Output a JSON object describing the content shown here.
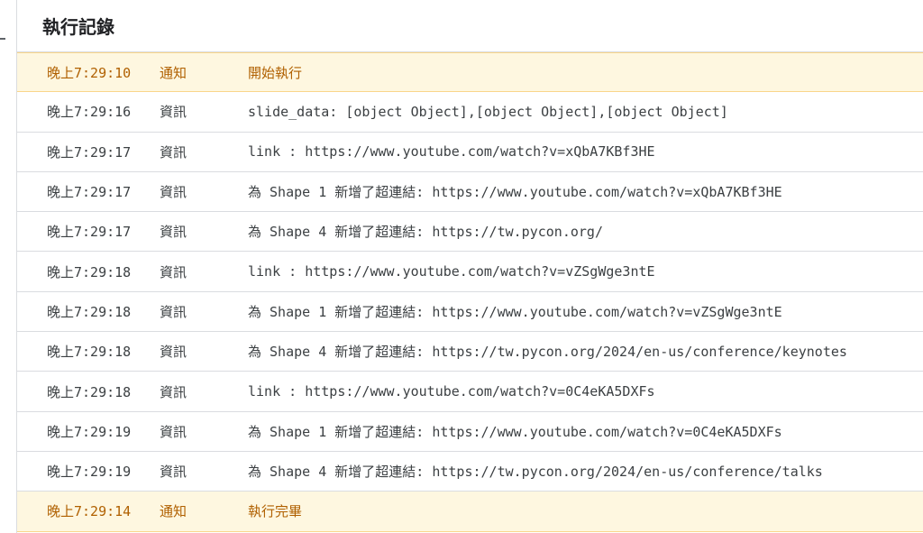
{
  "panel": {
    "title": "執行記錄"
  },
  "colors": {
    "notice_bg": "#fef7e0",
    "notice_text": "#b06000",
    "info_text": "#3c4043",
    "divider": "#dadce0"
  },
  "logs": [
    {
      "time": "晚上7:29:10",
      "level": "通知",
      "message": "開始執行",
      "type": "notice"
    },
    {
      "time": "晚上7:29:16",
      "level": "資訊",
      "message": "slide_data: [object Object],[object Object],[object Object]",
      "type": "info"
    },
    {
      "time": "晚上7:29:17",
      "level": "資訊",
      "message": "link : https://www.youtube.com/watch?v=xQbA7KBf3HE",
      "type": "info"
    },
    {
      "time": "晚上7:29:17",
      "level": "資訊",
      "message": "為 Shape 1 新增了超連結: https://www.youtube.com/watch?v=xQbA7KBf3HE",
      "type": "info"
    },
    {
      "time": "晚上7:29:17",
      "level": "資訊",
      "message": "為 Shape 4 新增了超連結: https://tw.pycon.org/",
      "type": "info"
    },
    {
      "time": "晚上7:29:18",
      "level": "資訊",
      "message": "link : https://www.youtube.com/watch?v=vZSgWge3ntE",
      "type": "info"
    },
    {
      "time": "晚上7:29:18",
      "level": "資訊",
      "message": "為 Shape 1 新增了超連結: https://www.youtube.com/watch?v=vZSgWge3ntE",
      "type": "info"
    },
    {
      "time": "晚上7:29:18",
      "level": "資訊",
      "message": "為 Shape 4 新增了超連結: https://tw.pycon.org/2024/en-us/conference/keynotes",
      "type": "info"
    },
    {
      "time": "晚上7:29:18",
      "level": "資訊",
      "message": "link : https://www.youtube.com/watch?v=0C4eKA5DXFs",
      "type": "info"
    },
    {
      "time": "晚上7:29:19",
      "level": "資訊",
      "message": "為 Shape 1 新增了超連結: https://www.youtube.com/watch?v=0C4eKA5DXFs",
      "type": "info"
    },
    {
      "time": "晚上7:29:19",
      "level": "資訊",
      "message": "為 Shape 4 新增了超連結: https://tw.pycon.org/2024/en-us/conference/talks",
      "type": "info"
    },
    {
      "time": "晚上7:29:14",
      "level": "通知",
      "message": "執行完畢",
      "type": "notice"
    }
  ]
}
